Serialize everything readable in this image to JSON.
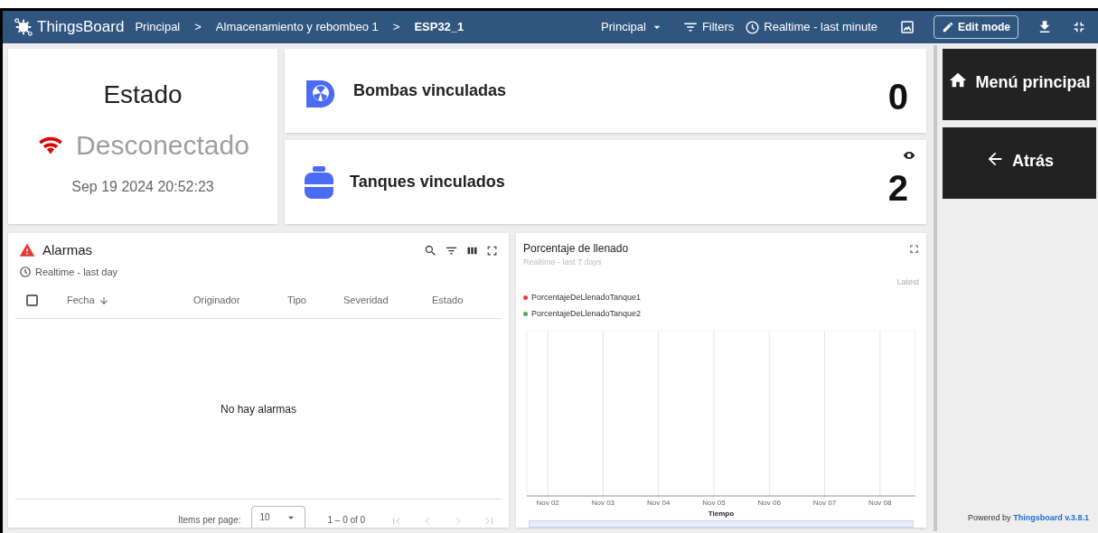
{
  "topbar": {
    "logo": "ThingsBoard",
    "breadcrumbs": [
      {
        "label": "Principal",
        "current": false
      },
      {
        "label": "Almacenamiento y rebombeo 1",
        "current": false
      },
      {
        "label": "ESP32_1",
        "current": true
      }
    ],
    "separator": ">",
    "state_menu": "Principal",
    "filters": "Filters",
    "timewindow": "Realtime - last minute",
    "edit_mode": "Edit mode"
  },
  "estado": {
    "title": "Estado",
    "status": "Desconectado",
    "connected": false,
    "timestamp": "Sep 19 2024 20:52:23"
  },
  "counters": [
    {
      "kind": "pump",
      "label": "Bombas vinculadas",
      "value": "0",
      "eye": false
    },
    {
      "kind": "tank",
      "label": "Tanques vinculados",
      "value": "2",
      "eye": true
    }
  ],
  "alarms": {
    "title": "Alarmas",
    "timewindow": "Realtime - last day",
    "columns": [
      {
        "label": "Fecha",
        "sorted": true
      },
      {
        "label": "Originador",
        "sorted": false
      },
      {
        "label": "Tipo",
        "sorted": false
      },
      {
        "label": "Severidad",
        "sorted": false
      },
      {
        "label": "Estado",
        "sorted": false
      }
    ],
    "all_checked": false,
    "empty": "No hay alarmas",
    "items_per_page_label": "Items per page:",
    "items_per_page": "10",
    "range": "1 – 0 of 0"
  },
  "fill_chart": {
    "title": "Porcentaje de llenado",
    "subtitle": "Realtime - last 7 days",
    "legend_header": "Latest",
    "legend": [
      {
        "name": "PorcentajeDeLlenadoTanque1",
        "color": "#f44336"
      },
      {
        "name": "PorcentajeDeLlenadoTanque2",
        "color": "#4caf50"
      }
    ],
    "x_tick_labels": [
      "Nov 02",
      "Nov 03",
      "Nov 04",
      "Nov 05",
      "Nov 06",
      "Nov 07",
      "Nov 08"
    ],
    "x_axis_title": "Tiempo"
  },
  "sidebar": {
    "buttons": [
      {
        "kind": "home",
        "label": "Menú principal"
      },
      {
        "kind": "back",
        "label": "Atrás"
      }
    ],
    "powered_by": "Powered by",
    "powered_link": "Thingsboard v.3.8.1"
  }
}
